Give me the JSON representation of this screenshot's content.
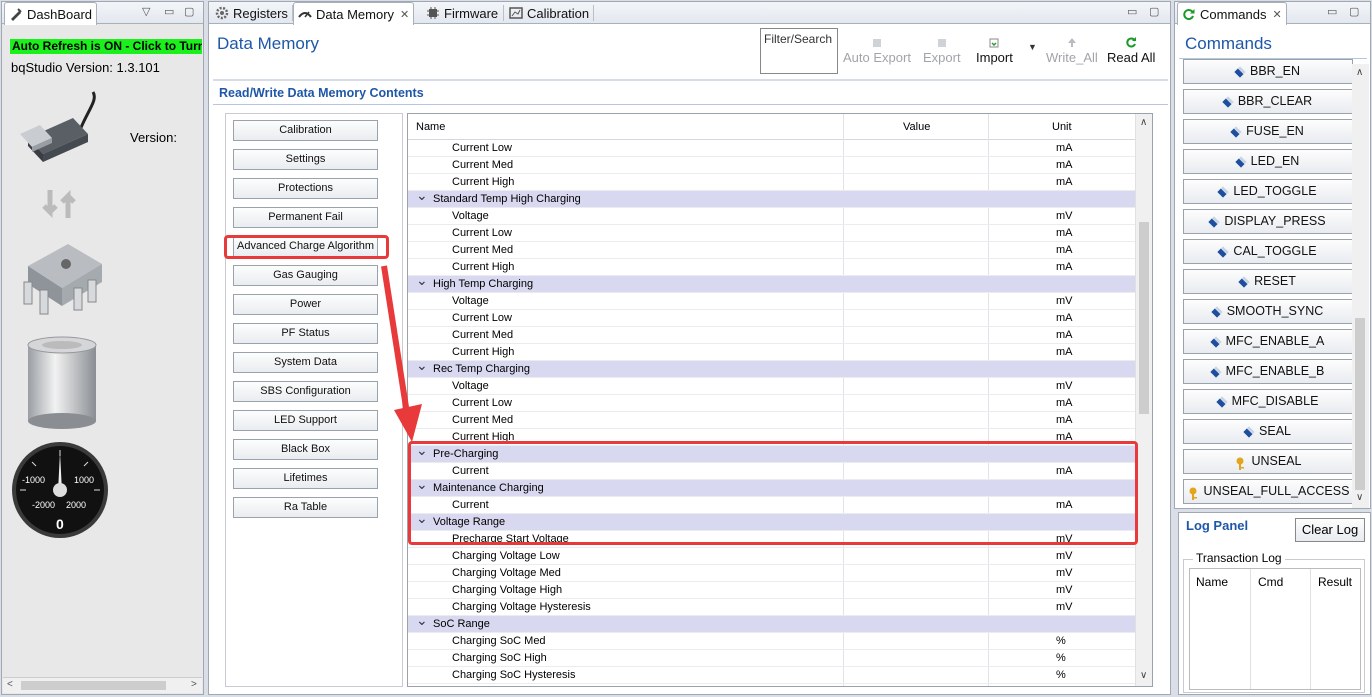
{
  "dashboard": {
    "tab_label": "DashBoard",
    "auto_refresh": "Auto Refresh is ON - Click to Turn",
    "version_line": "bqStudio Version:  1.3.101",
    "version_label": "Version:",
    "gauge": {
      "neg1000": "-1000",
      "pos1000": "1000",
      "neg2000": "-2000",
      "pos2000": "2000",
      "value": "0"
    }
  },
  "main_tabs": [
    "Registers",
    "Data Memory",
    "Firmware",
    "Calibration"
  ],
  "data_memory": {
    "title": "Data Memory",
    "filter_placeholder": "Filter/Search",
    "toolbar": {
      "auto_export": "Auto Export",
      "export": "Export",
      "import": "Import",
      "write_all": "Write_All",
      "read_all": "Read All"
    },
    "section_title": "Read/Write Data Memory Contents",
    "categories": [
      "Calibration",
      "Settings",
      "Protections",
      "Permanent Fail",
      "Advanced Charge Algorithm",
      "Gas Gauging",
      "Power",
      "PF Status",
      "System Data",
      "SBS Configuration",
      "LED Support",
      "Black Box",
      "Lifetimes",
      "Ra Table"
    ],
    "columns": {
      "name": "Name",
      "value": "Value",
      "unit": "Unit"
    },
    "rows": [
      {
        "name": "Current Low",
        "unit": "mA",
        "group": false
      },
      {
        "name": "Current Med",
        "unit": "mA",
        "group": false
      },
      {
        "name": "Current High",
        "unit": "mA",
        "group": false
      },
      {
        "name": "Standard Temp High Charging",
        "unit": "",
        "group": true
      },
      {
        "name": "Voltage",
        "unit": "mV",
        "group": false
      },
      {
        "name": "Current Low",
        "unit": "mA",
        "group": false
      },
      {
        "name": "Current Med",
        "unit": "mA",
        "group": false
      },
      {
        "name": "Current High",
        "unit": "mA",
        "group": false
      },
      {
        "name": "High Temp Charging",
        "unit": "",
        "group": true
      },
      {
        "name": "Voltage",
        "unit": "mV",
        "group": false
      },
      {
        "name": "Current Low",
        "unit": "mA",
        "group": false
      },
      {
        "name": "Current Med",
        "unit": "mA",
        "group": false
      },
      {
        "name": "Current High",
        "unit": "mA",
        "group": false
      },
      {
        "name": "Rec Temp Charging",
        "unit": "",
        "group": true
      },
      {
        "name": "Voltage",
        "unit": "mV",
        "group": false
      },
      {
        "name": "Current Low",
        "unit": "mA",
        "group": false
      },
      {
        "name": "Current Med",
        "unit": "mA",
        "group": false
      },
      {
        "name": "Current High",
        "unit": "mA",
        "group": false
      },
      {
        "name": "Pre-Charging",
        "unit": "",
        "group": true
      },
      {
        "name": "Current",
        "unit": "mA",
        "group": false
      },
      {
        "name": "Maintenance Charging",
        "unit": "",
        "group": true
      },
      {
        "name": "Current",
        "unit": "mA",
        "group": false
      },
      {
        "name": "Voltage Range",
        "unit": "",
        "group": true
      },
      {
        "name": "Precharge Start Voltage",
        "unit": "mV",
        "group": false
      },
      {
        "name": "Charging Voltage Low",
        "unit": "mV",
        "group": false
      },
      {
        "name": "Charging Voltage Med",
        "unit": "mV",
        "group": false
      },
      {
        "name": "Charging Voltage High",
        "unit": "mV",
        "group": false
      },
      {
        "name": "Charging Voltage Hysteresis",
        "unit": "mV",
        "group": false
      },
      {
        "name": "SoC Range",
        "unit": "",
        "group": true
      },
      {
        "name": "Charging SoC Med",
        "unit": "%",
        "group": false
      },
      {
        "name": "Charging SoC High",
        "unit": "%",
        "group": false
      },
      {
        "name": "Charging SoC Hysteresis",
        "unit": "%",
        "group": false
      }
    ]
  },
  "commands": {
    "tab_label": "Commands",
    "title": "Commands",
    "buttons": [
      "BBR_EN",
      "BBR_CLEAR",
      "FUSE_EN",
      "LED_EN",
      "LED_TOGGLE",
      "DISPLAY_PRESS",
      "CAL_TOGGLE",
      "RESET",
      "SMOOTH_SYNC",
      "MFC_ENABLE_A",
      "MFC_ENABLE_B",
      "MFC_DISABLE",
      "SEAL",
      "UNSEAL",
      "UNSEAL_FULL_ACCESS"
    ]
  },
  "log_panel": {
    "title": "Log Panel",
    "clear_label": "Clear Log",
    "transaction_label": "Transaction Log",
    "columns": [
      "Name",
      "Cmd",
      "Result"
    ]
  },
  "colors": {
    "accent": "#1f57a8",
    "highlight": "#e83a3a",
    "green": "#1cf01c",
    "group_row": "#d8d8f0"
  }
}
